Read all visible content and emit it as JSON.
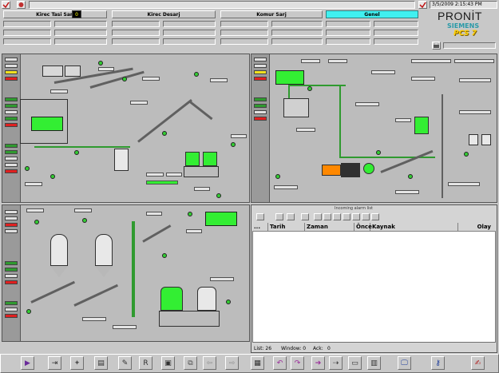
{
  "header": {
    "sections": [
      {
        "label": "Kirec Tasi Sarj",
        "highlight": false
      },
      {
        "label": "Kirec Desarj",
        "highlight": false
      },
      {
        "label": "Komur Sarj",
        "highlight": false
      },
      {
        "label": "Genel",
        "highlight": true
      }
    ],
    "indicator_value": "0",
    "datetime": "3/5/2009 2:15:43 PM",
    "brand": "PRONİT",
    "siemens": "SIEMENS",
    "pcs7": "PCS 7"
  },
  "colors": {
    "background": "#c8c8c8",
    "green": "#33ee33",
    "dark_green": "#2f9a2f",
    "red": "#e02020",
    "yellow": "#f0e020",
    "cyan": "#40f0f0",
    "brand_blue": "#2a6aa8"
  },
  "alarm": {
    "title": "Incoming alarm list",
    "columns": [
      "...",
      "Tarih",
      "Zaman",
      "Önce",
      "Kaynak",
      "Olay"
    ],
    "status": {
      "list": "List: 26",
      "window": "Window: 0",
      "ack": "Ack:",
      "ack_count": "0"
    }
  },
  "toolbar": {
    "buttons": [
      {
        "name": "play-icon",
        "glyph": "▶"
      },
      {
        "name": "trend-icon",
        "glyph": "⇥"
      },
      {
        "name": "star-doc-icon",
        "glyph": "✦"
      },
      {
        "name": "document-icon",
        "glyph": "▤"
      },
      {
        "name": "edit-icon",
        "glyph": "✎"
      },
      {
        "name": "report-icon",
        "glyph": "R"
      },
      {
        "name": "window-icon",
        "glyph": "▣"
      },
      {
        "name": "windows-icon",
        "glyph": "⧉"
      },
      {
        "name": "left-arrow-icon",
        "glyph": "⇦"
      },
      {
        "name": "right-arrow-icon",
        "glyph": "⇨"
      },
      {
        "name": "layout-icon",
        "glyph": "▦"
      },
      {
        "name": "undo-icon",
        "glyph": "↶"
      },
      {
        "name": "redo-icon",
        "glyph": "↷"
      },
      {
        "name": "forward-icon",
        "glyph": "➔"
      },
      {
        "name": "next-icon",
        "glyph": "⇢"
      },
      {
        "name": "screen-icon",
        "glyph": "▭"
      },
      {
        "name": "overview-icon",
        "glyph": "▥"
      },
      {
        "name": "monitor-icon",
        "glyph": "🖵"
      },
      {
        "name": "key-icon",
        "glyph": "⚷"
      },
      {
        "name": "signature-icon",
        "glyph": "✍"
      }
    ]
  }
}
